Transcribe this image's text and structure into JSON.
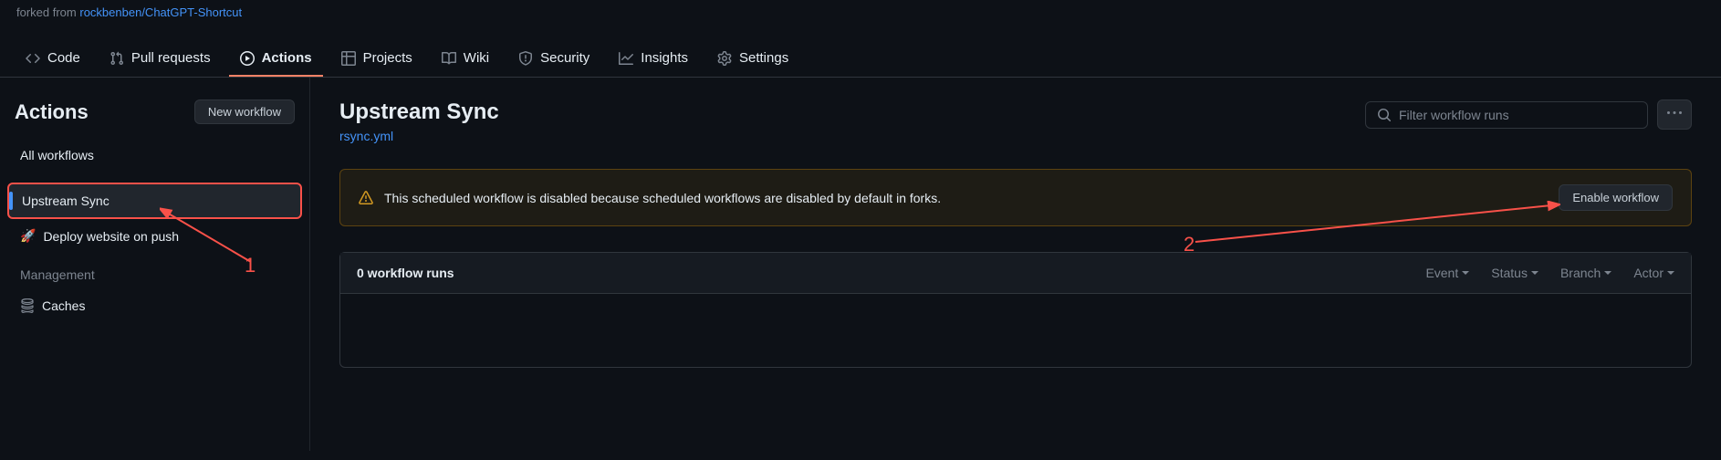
{
  "fork": {
    "prefix": "forked from",
    "repo": "rockbenben/ChatGPT-Shortcut"
  },
  "nav": {
    "code": "Code",
    "pull_requests": "Pull requests",
    "actions": "Actions",
    "projects": "Projects",
    "wiki": "Wiki",
    "security": "Security",
    "insights": "Insights",
    "settings": "Settings"
  },
  "sidebar": {
    "title": "Actions",
    "new_workflow": "New workflow",
    "all_workflows": "All workflows",
    "workflows": [
      {
        "label": "Upstream Sync"
      },
      {
        "label": "Deploy website on push"
      }
    ],
    "management_label": "Management",
    "caches": "Caches"
  },
  "content": {
    "title": "Upstream Sync",
    "file": "rsync.yml",
    "filter_placeholder": "Filter workflow runs",
    "warning_text": "This scheduled workflow is disabled because scheduled workflows are disabled by default in forks.",
    "enable_label": "Enable workflow",
    "runs_count": "0 workflow runs",
    "filters": {
      "event": "Event",
      "status": "Status",
      "branch": "Branch",
      "actor": "Actor"
    }
  },
  "annotations": {
    "one": "1",
    "two": "2"
  }
}
